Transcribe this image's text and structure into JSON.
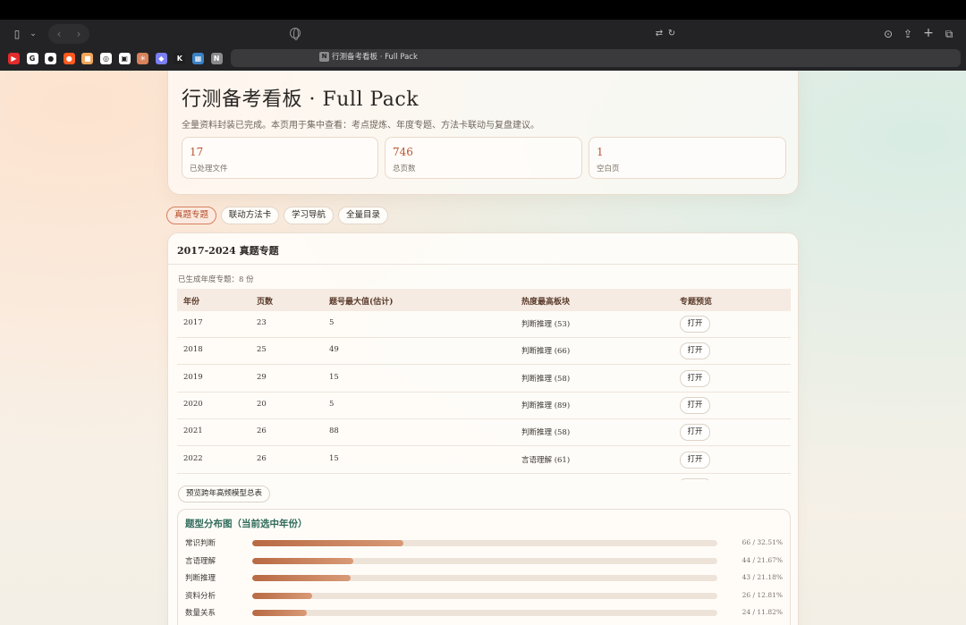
{
  "browser": {
    "tab_title": "行测备考看板 · Full Pack",
    "tab_icon": "N",
    "favicons": [
      {
        "icon": "youtube-icon",
        "color": "#e32b2b",
        "glyph": "▶"
      },
      {
        "icon": "google-icon",
        "color": "#ffffff",
        "glyph": "G"
      },
      {
        "icon": "github-icon",
        "color": "#ffffff",
        "glyph": "●"
      },
      {
        "icon": "reddit-icon",
        "color": "#ff5a1f",
        "glyph": "●"
      },
      {
        "icon": "bookmark-orange-icon",
        "color": "#f1a65a",
        "glyph": "■"
      },
      {
        "icon": "openai-icon",
        "color": "#ffffff",
        "glyph": "◎"
      },
      {
        "icon": "notion-icon",
        "color": "#ffffff",
        "glyph": "▣"
      },
      {
        "icon": "claude-icon",
        "color": "#d9825b",
        "glyph": "✳"
      },
      {
        "icon": "linear-icon",
        "color": "#7b7ff4",
        "glyph": "◆"
      },
      {
        "icon": "kimi-icon",
        "color": "#1f1f1f",
        "glyph": "K"
      },
      {
        "icon": "calendar-icon",
        "color": "#3b82c4",
        "glyph": "▦"
      },
      {
        "icon": "n-app-icon",
        "color": "#8a8a8e",
        "glyph": "N"
      }
    ]
  },
  "hero": {
    "title": "行测备考看板 · Full Pack",
    "description": "全量资料封装已完成。本页用于集中查看：考点提炼、年度专题、方法卡联动与复盘建议。",
    "stats": [
      {
        "value": "17",
        "label": "已处理文件"
      },
      {
        "value": "746",
        "label": "总页数"
      },
      {
        "value": "1",
        "label": "空白页"
      }
    ]
  },
  "tabs": [
    {
      "label": "真题专题",
      "active": true
    },
    {
      "label": "联动方法卡",
      "active": false
    },
    {
      "label": "学习导航",
      "active": false
    },
    {
      "label": "全量目录",
      "active": false
    }
  ],
  "topic_card": {
    "title": "2017-2024 真题专题",
    "generated_note": "已生成年度专题：8 份",
    "columns": [
      "年份",
      "页数",
      "题号最大值(估计)",
      "热度最高板块",
      "专题预览"
    ],
    "rows": [
      {
        "year": "2017",
        "pages": "23",
        "max_q": "5",
        "hot": "判断推理 (53)",
        "action": "打开"
      },
      {
        "year": "2018",
        "pages": "25",
        "max_q": "49",
        "hot": "判断推理 (66)",
        "action": "打开"
      },
      {
        "year": "2019",
        "pages": "29",
        "max_q": "15",
        "hot": "判断推理 (58)",
        "action": "打开"
      },
      {
        "year": "2020",
        "pages": "20",
        "max_q": "5",
        "hot": "判断推理 (89)",
        "action": "打开"
      },
      {
        "year": "2021",
        "pages": "26",
        "max_q": "88",
        "hot": "判断推理 (58)",
        "action": "打开"
      },
      {
        "year": "2022",
        "pages": "26",
        "max_q": "15",
        "hot": "言语理解 (61)",
        "action": "打开"
      }
    ],
    "preview_button": "预览跨年高频模型总表"
  },
  "distribution": {
    "title": "题型分布图（当前选中年份）",
    "items": [
      {
        "label": "常识判断",
        "fraction": 0.3251,
        "value_text": "66 / 32.51%"
      },
      {
        "label": "言语理解",
        "fraction": 0.2167,
        "value_text": "44 / 21.67%"
      },
      {
        "label": "判断推理",
        "fraction": 0.2118,
        "value_text": "43 / 21.18%"
      },
      {
        "label": "资料分析",
        "fraction": 0.1281,
        "value_text": "26 / 12.81%"
      },
      {
        "label": "数量关系",
        "fraction": 0.1182,
        "value_text": "24 / 11.82%"
      }
    ]
  }
}
